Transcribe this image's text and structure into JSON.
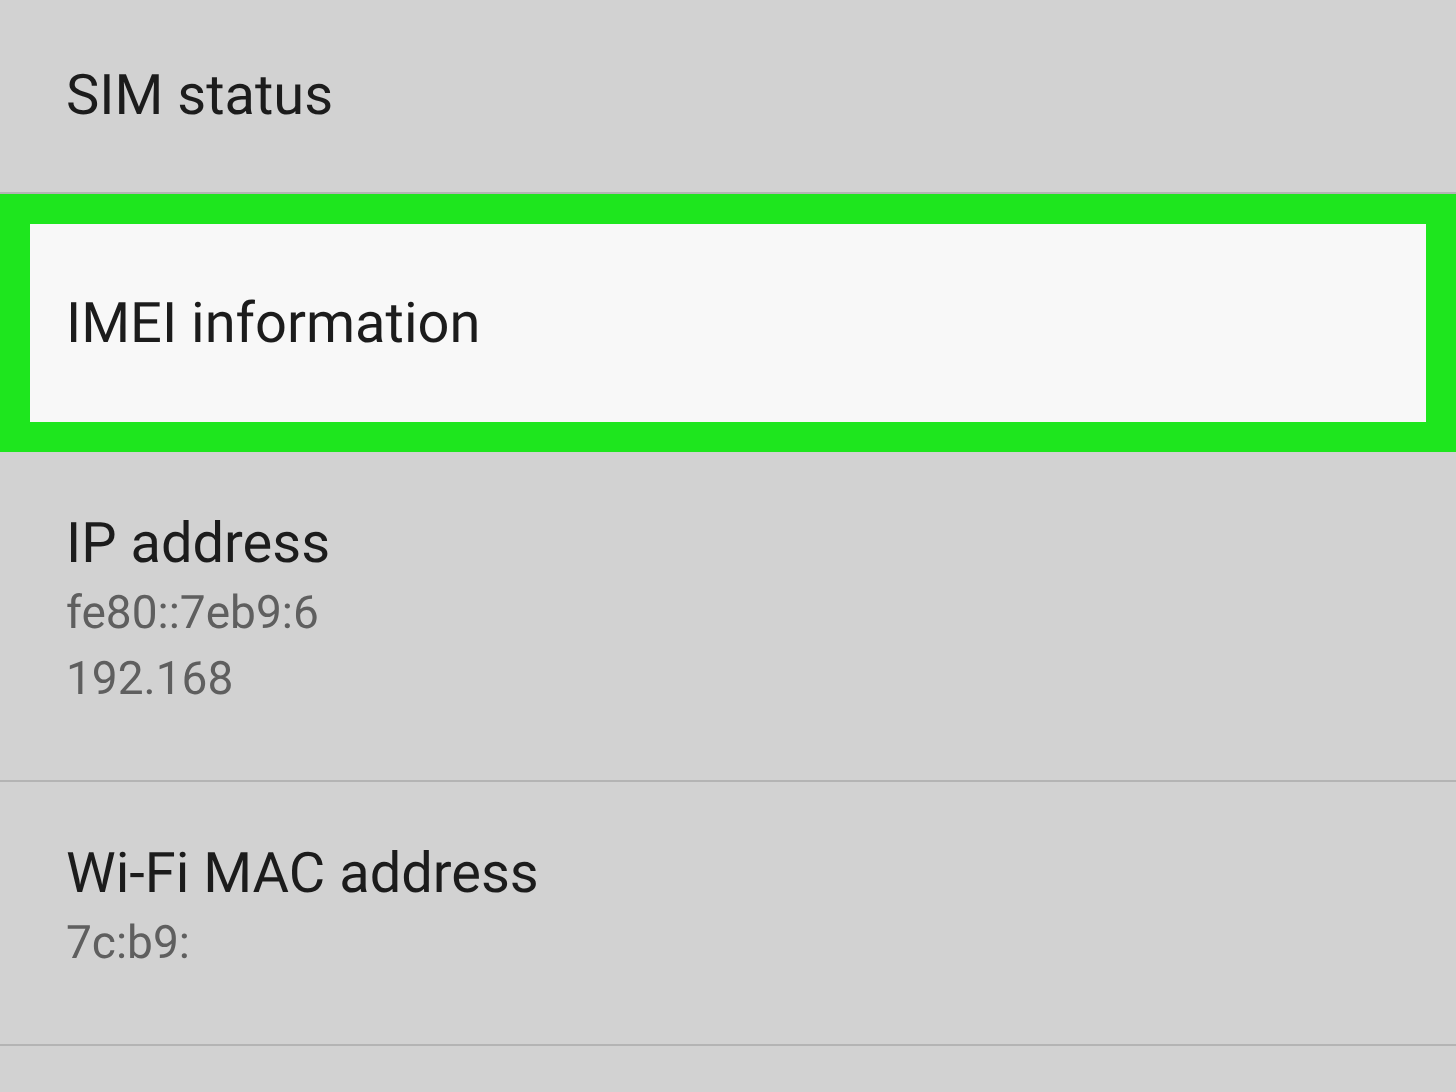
{
  "settings_items": [
    {
      "title": "SIM status",
      "highlighted": false
    },
    {
      "title": "IMEI information",
      "highlighted": true
    },
    {
      "title": "IP address",
      "details": [
        "fe80::7eb9:6",
        "192.168"
      ],
      "highlighted": false
    },
    {
      "title": "Wi-Fi MAC address",
      "details": [
        "7c:b9:"
      ],
      "highlighted": false
    }
  ]
}
